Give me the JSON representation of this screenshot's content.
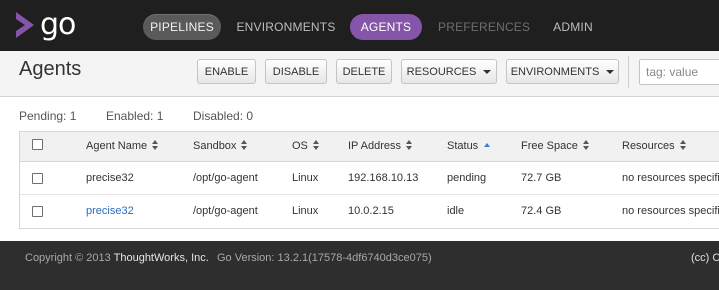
{
  "header": {
    "logo_text": "go",
    "nav": [
      {
        "label": "PIPELINES",
        "state": "hover"
      },
      {
        "label": "ENVIRONMENTS",
        "state": "normal"
      },
      {
        "label": "AGENTS",
        "state": "active"
      },
      {
        "label": "PREFERENCES",
        "state": "disabled"
      },
      {
        "label": "ADMIN",
        "state": "normal"
      }
    ]
  },
  "toolbar": {
    "title": "Agents",
    "enable": "ENABLE",
    "disable": "DISABLE",
    "delete": "DELETE",
    "resources": "RESOURCES",
    "environments": "ENVIRONMENTS",
    "filter_placeholder": "tag: value"
  },
  "summary": {
    "pending": "Pending: 1",
    "enabled": "Enabled: 1",
    "disabled": "Disabled: 0"
  },
  "table": {
    "columns": [
      "Agent Name",
      "Sandbox",
      "OS",
      "IP Address",
      "Status",
      "Free Space",
      "Resources"
    ],
    "sorted_column": "Status",
    "rows": [
      {
        "name": "precise32",
        "sandbox": "/opt/go-agent",
        "os": "Linux",
        "ip": "192.168.10.13",
        "status": "pending",
        "free_space": "72.7 GB",
        "resources": "no resources specified",
        "checked": false
      },
      {
        "name": "precise32",
        "sandbox": "/opt/go-agent",
        "os": "Linux",
        "ip": "10.0.2.15",
        "status": "idle",
        "free_space": "72.4 GB",
        "resources": "no resources specified",
        "checked": false
      }
    ]
  },
  "footer": {
    "copyright_prefix": "Copyright © 2013 ",
    "company": "ThoughtWorks, Inc.",
    "version": "Go Version: 13.2.1(17578-4df6740d3ce075)",
    "license": "(cc) C"
  },
  "colors": {
    "topbar": "#1f1f1f",
    "agents_tab": "#8455a8",
    "pipelines_tab": "#5a5a5a",
    "footer": "#2e2e2e",
    "link": "#2a6ebb"
  }
}
